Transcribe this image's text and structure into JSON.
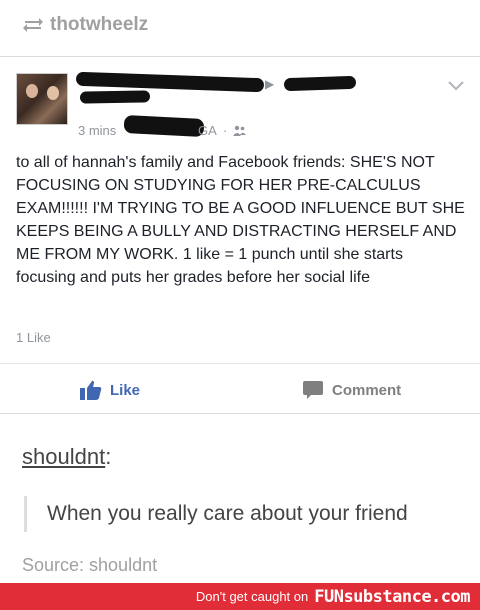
{
  "header": {
    "username": "thotwheelz",
    "reblog_icon": "reblog-icon"
  },
  "post": {
    "time": "3 mins",
    "location_fragment": "GA",
    "separator": "·",
    "privacy_icon": "friends-icon",
    "body": "to all of hannah's family and Facebook friends: SHE'S NOT FOCUSING ON STUDYING FOR HER PRE-CALCULUS EXAM!!!!!! I'M TRYING TO BE A GOOD INFLUENCE BUT SHE KEEPS BEING A BULLY AND DISTRACTING HERSELF AND ME FROM MY WORK. 1 like = 1 punch until she starts focusing and puts her grades before her social life",
    "likes_count": "1 Like",
    "like_label": "Like",
    "comment_label": "Comment"
  },
  "reblog": {
    "name": "shouldnt",
    "colon": ":",
    "quote": "When you really care about your friend",
    "source": "Source: shouldnt"
  },
  "banner": {
    "text": "Don't get caught on",
    "brand": "FUNsubstance.com"
  },
  "colors": {
    "facebook_blue": "#4267b2",
    "banner_red": "#e02d38",
    "muted_gray": "#90949c"
  }
}
